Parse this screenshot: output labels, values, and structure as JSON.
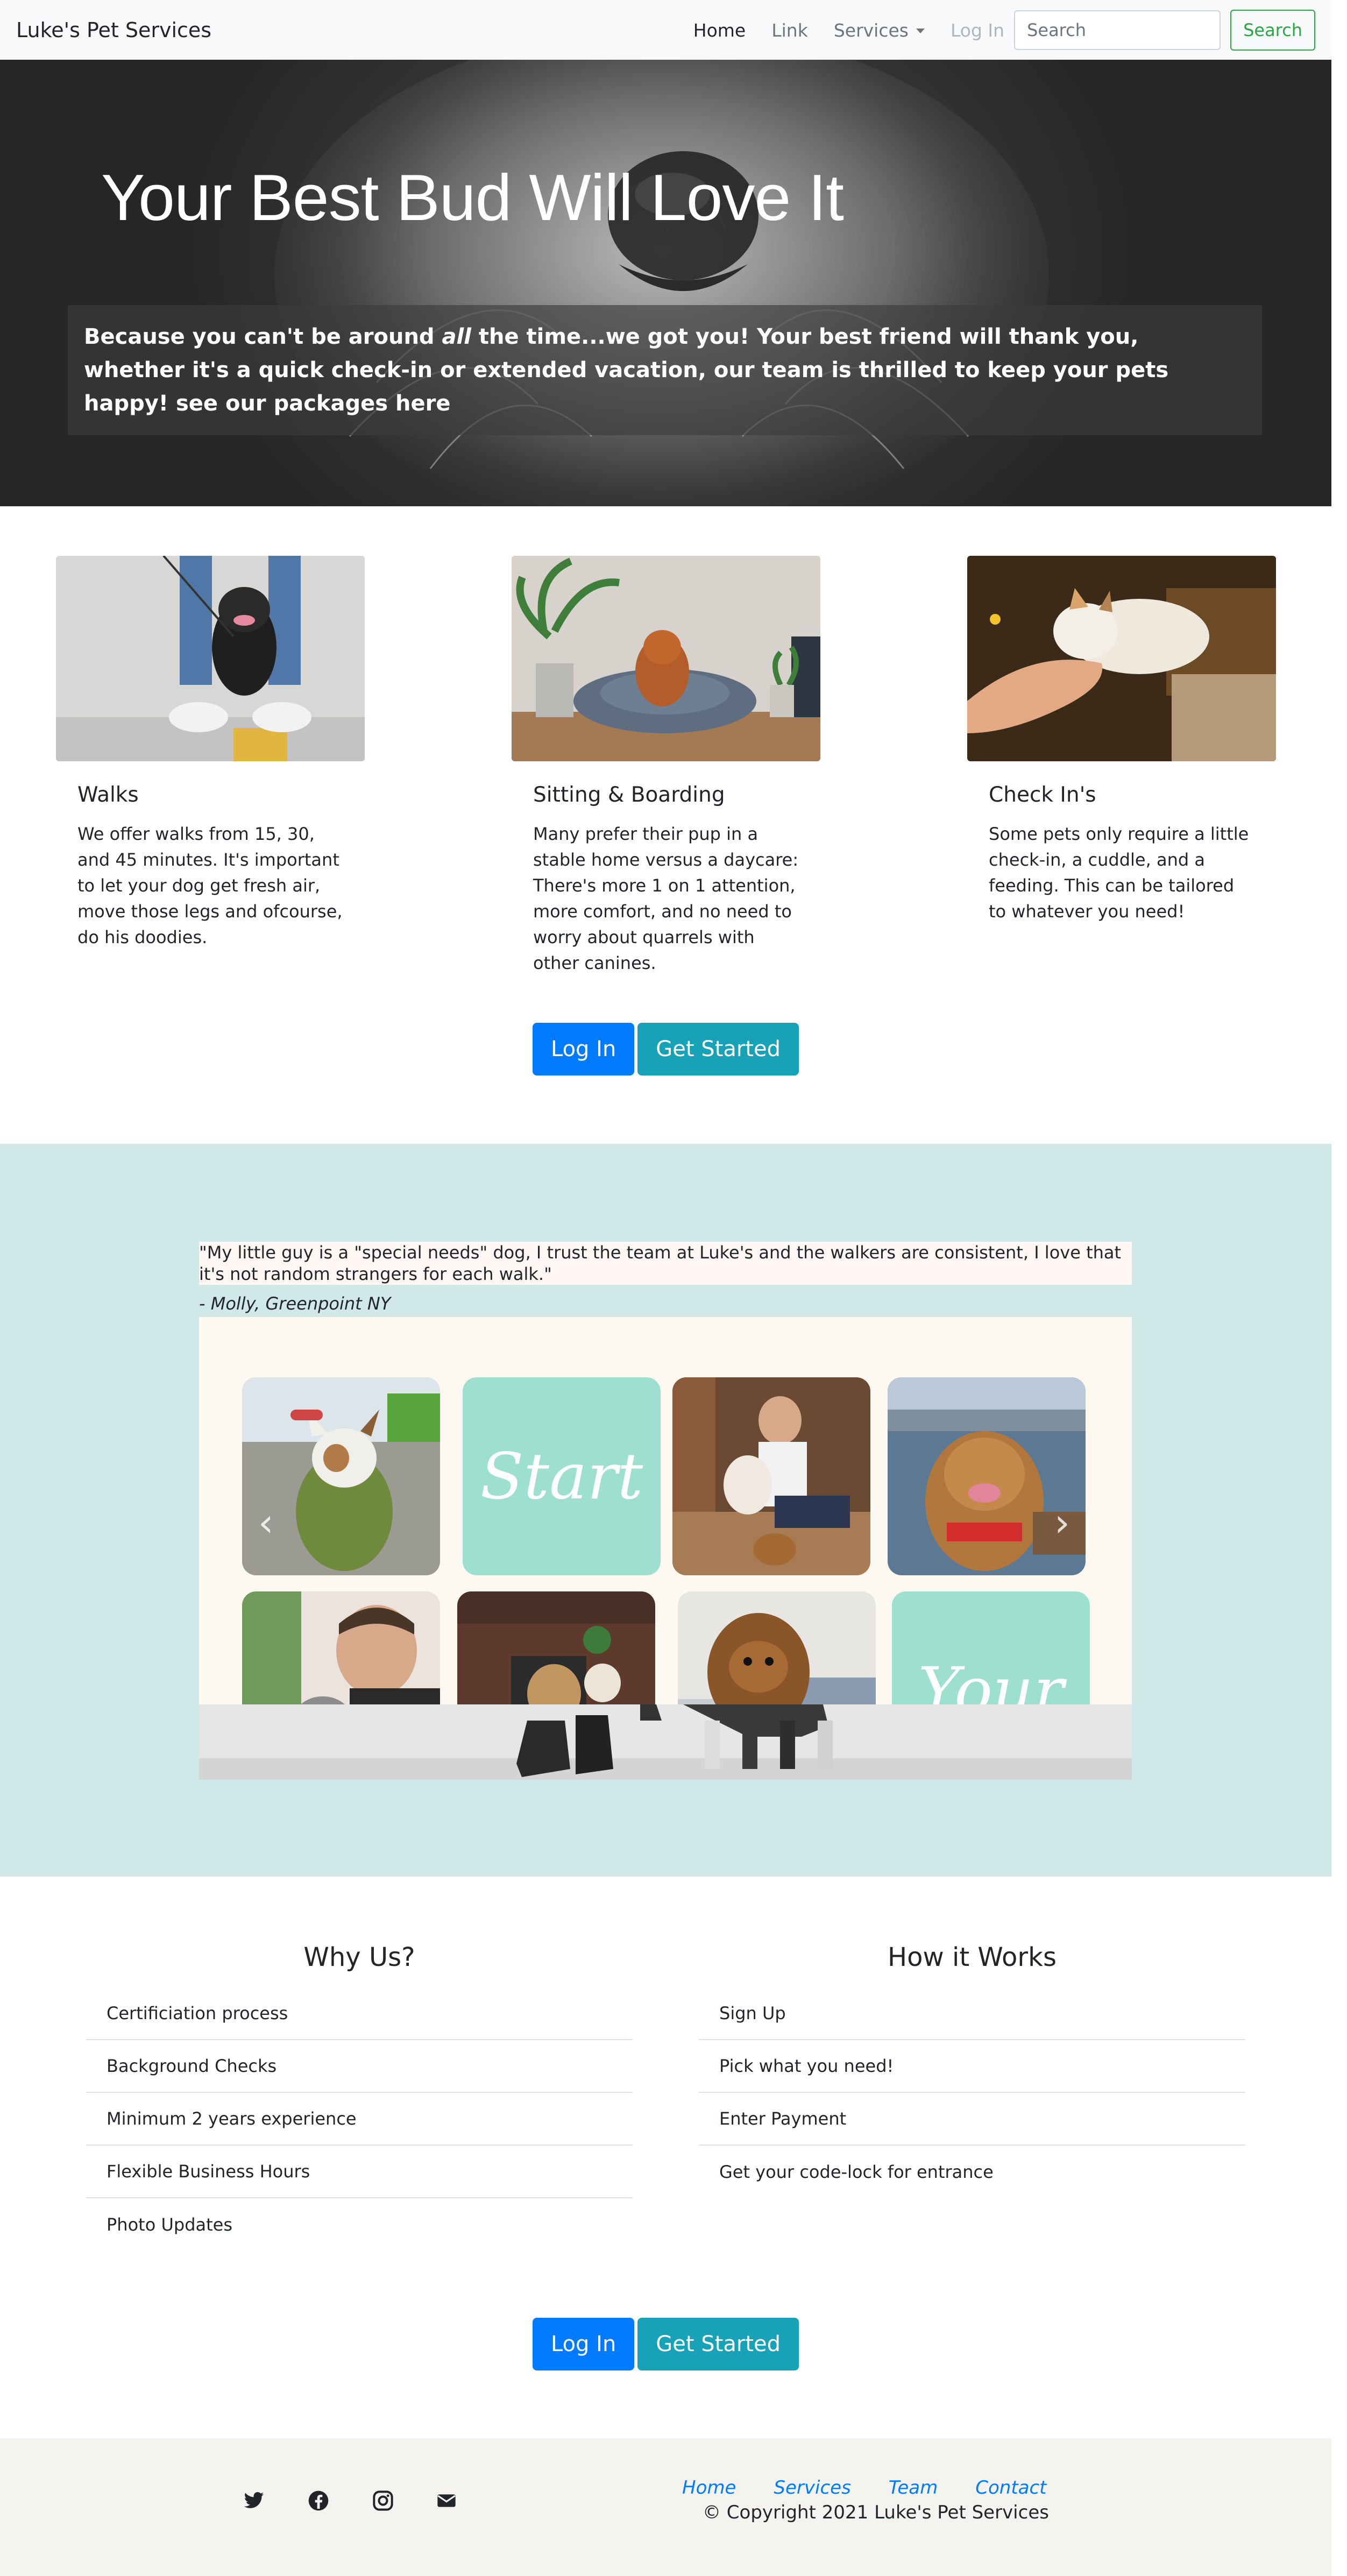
{
  "navbar": {
    "brand": "Luke's Pet Services",
    "links": [
      "Home",
      "Link",
      "Services",
      "Log In"
    ],
    "search_placeholder": "Search",
    "search_button": "Search"
  },
  "hero": {
    "title": "Your Best Bud Will Love It",
    "lead_before": "Because you can't be around ",
    "lead_emphasis": "all",
    "lead_after": " the time...we got you! Your best friend will thank you, whether it's a quick check-in or extended vacation, our team is thrilled to keep your pets happy! see our packages here"
  },
  "cards": [
    {
      "title": "Walks",
      "text": "We offer walks from 15, 30, and 45 minutes. It's important to let your dog get fresh air, move those legs and ofcourse, do his doodies."
    },
    {
      "title": "Sitting & Boarding",
      "text": "Many prefer their pup in a stable home versus a daycare: There's more 1 on 1 attention, more comfort, and no need to worry about quarrels with other canines."
    },
    {
      "title": "Check In's",
      "text": "Some pets only require a little check-in, a cuddle, and a feeding. This can be tailored to whatever you need!"
    }
  ],
  "cta": {
    "login": "Log In",
    "get_started": "Get Started"
  },
  "testimonial": {
    "quote": "\"My little guy is a \"special needs\" dog, I trust the team at Luke's and the walkers are consistent, I love that it's not random strangers for each walk.\"",
    "author": "- Molly, Greenpoint NY",
    "tile_words": [
      "Start",
      "Your"
    ]
  },
  "why_us": {
    "title": "Why Us?",
    "items": [
      "Certificiation process",
      "Background Checks",
      "Minimum 2 years experience",
      "Flexible Business Hours",
      "Photo Updates"
    ]
  },
  "how_it_works": {
    "title": "How it Works",
    "items": [
      "Sign Up",
      "Pick what you need!",
      "Enter Payment",
      "Get your code-lock for entrance"
    ]
  },
  "footer": {
    "social_icons": [
      "twitter-icon",
      "facebook-icon",
      "instagram-icon",
      "envelope-icon"
    ],
    "links": [
      "Home",
      "Services",
      "Team",
      "Contact"
    ],
    "copyright": "© Copyright 2021 Luke's Pet Services"
  },
  "colors": {
    "primary": "#007bff",
    "info": "#17a2b8",
    "success": "#28a745",
    "testimonial_bg": "#d0e9e8",
    "footer_bg": "#f4f3ef"
  }
}
